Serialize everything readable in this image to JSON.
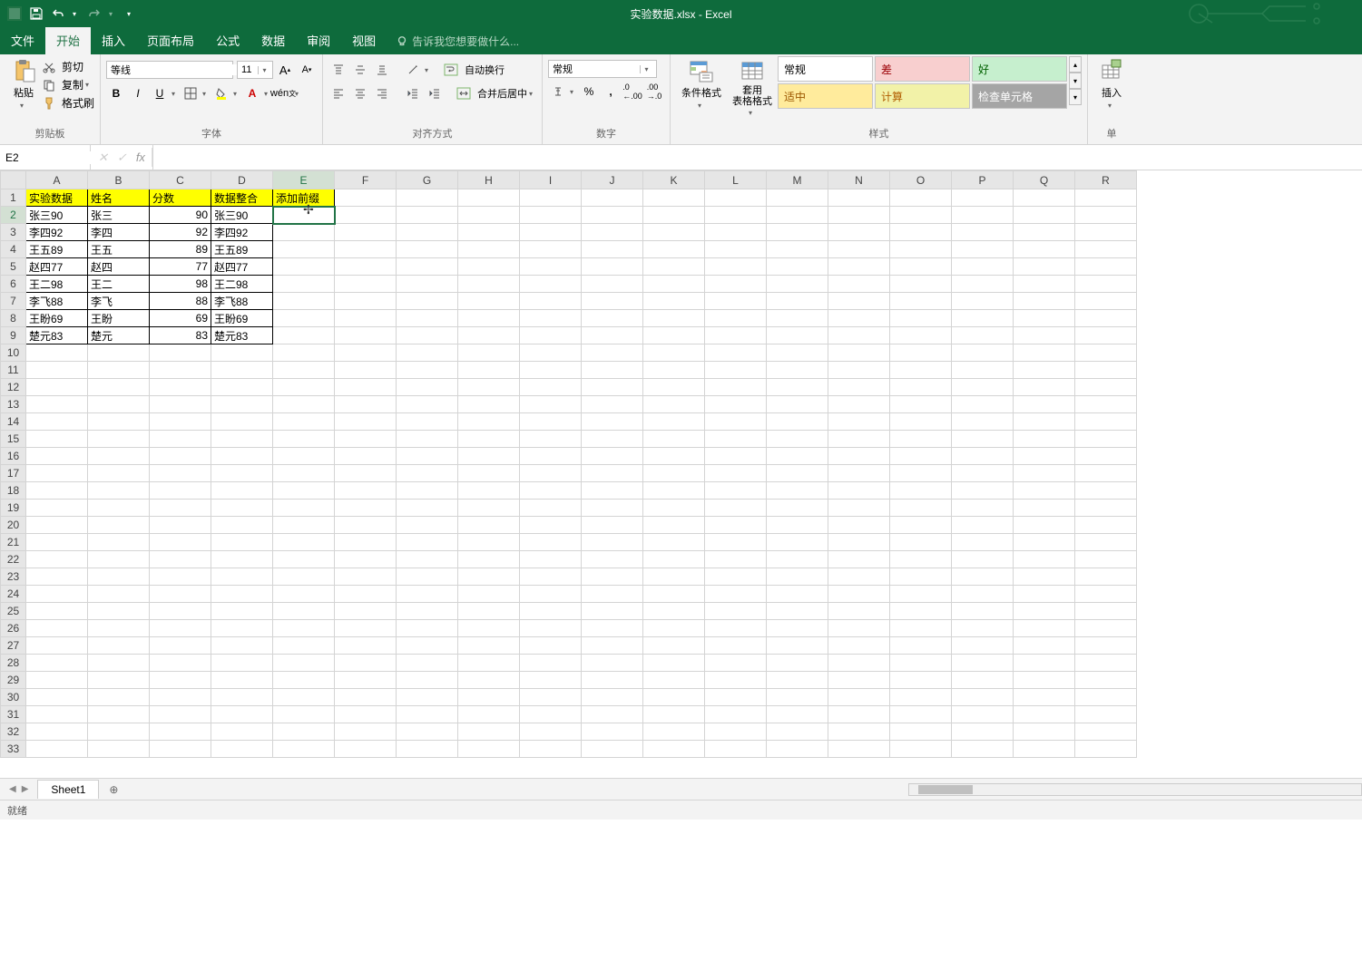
{
  "app": {
    "title": "实验数据.xlsx - Excel"
  },
  "qat": {
    "save": "save",
    "undo": "undo",
    "redo": "redo"
  },
  "tabs": {
    "file": "文件",
    "home": "开始",
    "insert": "插入",
    "layout": "页面布局",
    "formulas": "公式",
    "data": "数据",
    "review": "审阅",
    "view": "视图",
    "tell_me": "告诉我您想要做什么..."
  },
  "ribbon": {
    "clipboard": {
      "paste": "粘贴",
      "cut": "剪切",
      "copy": "复制",
      "format_painter": "格式刷",
      "label": "剪贴板"
    },
    "font": {
      "name": "等线",
      "size": "11",
      "label": "字体"
    },
    "align": {
      "wrap": "自动换行",
      "merge": "合并后居中",
      "label": "对齐方式"
    },
    "number": {
      "format": "常规",
      "label": "数字"
    },
    "styles": {
      "cond": "条件格式",
      "table": "套用\n表格格式",
      "s1": "常规",
      "s2": "差",
      "s3": "好",
      "s4": "适中",
      "s5": "计算",
      "s6": "检查单元格",
      "label": "样式"
    },
    "cells": {
      "insert": "插入",
      "label": "单"
    }
  },
  "formula_bar": {
    "name_box": "E2",
    "formula": ""
  },
  "columns": [
    "A",
    "B",
    "C",
    "D",
    "E",
    "F",
    "G",
    "H",
    "I",
    "J",
    "K",
    "L",
    "M",
    "N",
    "O",
    "P",
    "Q",
    "R"
  ],
  "headers": {
    "A": "实验数据",
    "B": "姓名",
    "C": "分数",
    "D": "数据整合",
    "E": "添加前缀"
  },
  "rows": [
    {
      "a": "张三90",
      "b": "张三",
      "c": 90,
      "d": "张三90"
    },
    {
      "a": "李四92",
      "b": "李四",
      "c": 92,
      "d": "李四92"
    },
    {
      "a": "王五89",
      "b": "王五",
      "c": 89,
      "d": "王五89"
    },
    {
      "a": "赵四77",
      "b": "赵四",
      "c": 77,
      "d": "赵四77"
    },
    {
      "a": "王二98",
      "b": "王二",
      "c": 98,
      "d": "王二98"
    },
    {
      "a": "李飞88",
      "b": "李飞",
      "c": 88,
      "d": "李飞88"
    },
    {
      "a": "王盼69",
      "b": "王盼",
      "c": 69,
      "d": "王盼69"
    },
    {
      "a": "楚元83",
      "b": "楚元",
      "c": 83,
      "d": "楚元83"
    }
  ],
  "total_rows": 33,
  "sheet_tabs": {
    "sheet1": "Sheet1"
  },
  "status": {
    "ready": "就绪"
  },
  "style_colors": {
    "s1": "#ffffff",
    "s2": "#f8cfcf",
    "s3": "#c6efce",
    "s4": "#ffeb9c",
    "s5": "#f2f2a8",
    "s6": "#a5a5a5"
  }
}
